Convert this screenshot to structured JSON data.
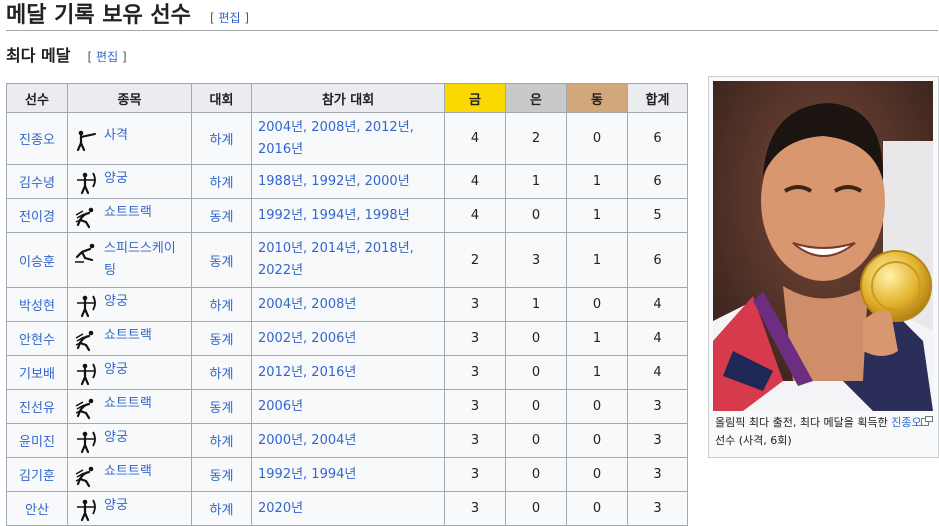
{
  "section_title": "메달 기록 보유 선수",
  "section_edit": "편집",
  "subsection_title": "최다 메달",
  "subsection_edit": "편집",
  "colors": {
    "gold": "#f9d900",
    "silver": "#c9c9c9",
    "bronze": "#d2a77a",
    "link": "#3366cc"
  },
  "table": {
    "headers": [
      "선수",
      "종목",
      "대회",
      "참가 대회",
      "금",
      "은",
      "동",
      "합계"
    ],
    "rows": [
      {
        "name": "진종오",
        "event": "사격",
        "icon": "shooting-pictogram-icon",
        "season": "하계",
        "games": "2004년, 2008년, 2012년, 2016년",
        "gold": "4",
        "silver": "2",
        "bronze": "0",
        "total": "6"
      },
      {
        "name": "김수녕",
        "event": "양궁",
        "icon": "archery-pictogram-icon",
        "season": "하계",
        "games": "1988년, 1992년, 2000년",
        "gold": "4",
        "silver": "1",
        "bronze": "1",
        "total": "6"
      },
      {
        "name": "전이경",
        "event": "쇼트트랙",
        "icon": "short-track-pictogram-icon",
        "season": "동계",
        "games": "1992년, 1994년, 1998년",
        "gold": "4",
        "silver": "0",
        "bronze": "1",
        "total": "5"
      },
      {
        "name": "이승훈",
        "event": "스피드스케이팅",
        "icon": "speed-skating-pictogram-icon",
        "season": "동계",
        "games": "2010년, 2014년, 2018년, 2022년",
        "gold": "2",
        "silver": "3",
        "bronze": "1",
        "total": "6"
      },
      {
        "name": "박성현",
        "event": "양궁",
        "icon": "archery-pictogram-icon",
        "season": "하계",
        "games": "2004년, 2008년",
        "gold": "3",
        "silver": "1",
        "bronze": "0",
        "total": "4"
      },
      {
        "name": "안현수",
        "event": "쇼트트랙",
        "icon": "short-track-pictogram-icon",
        "season": "동계",
        "games": "2002년, 2006년",
        "gold": "3",
        "silver": "0",
        "bronze": "1",
        "total": "4"
      },
      {
        "name": "기보배",
        "event": "양궁",
        "icon": "archery-pictogram-icon",
        "season": "하계",
        "games": "2012년, 2016년",
        "gold": "3",
        "silver": "0",
        "bronze": "1",
        "total": "4"
      },
      {
        "name": "진선유",
        "event": "쇼트트랙",
        "icon": "short-track-pictogram-icon",
        "season": "동계",
        "games": "2006년",
        "gold": "3",
        "silver": "0",
        "bronze": "0",
        "total": "3"
      },
      {
        "name": "윤미진",
        "event": "양궁",
        "icon": "archery-pictogram-icon",
        "season": "하계",
        "games": "2000년, 2004년",
        "gold": "3",
        "silver": "0",
        "bronze": "0",
        "total": "3"
      },
      {
        "name": "김기훈",
        "event": "쇼트트랙",
        "icon": "short-track-pictogram-icon",
        "season": "동계",
        "games": "1992년, 1994년",
        "gold": "3",
        "silver": "0",
        "bronze": "0",
        "total": "3"
      },
      {
        "name": "안산",
        "event": "양궁",
        "icon": "archery-pictogram-icon",
        "season": "하계",
        "games": "2020년",
        "gold": "3",
        "silver": "0",
        "bronze": "0",
        "total": "3"
      }
    ]
  },
  "image_caption": {
    "text_before": "올림픽 최다 출전, 최다 메달을 획득한 ",
    "link": "진종오",
    "text_after": " 선수 (사격, 6회)"
  }
}
